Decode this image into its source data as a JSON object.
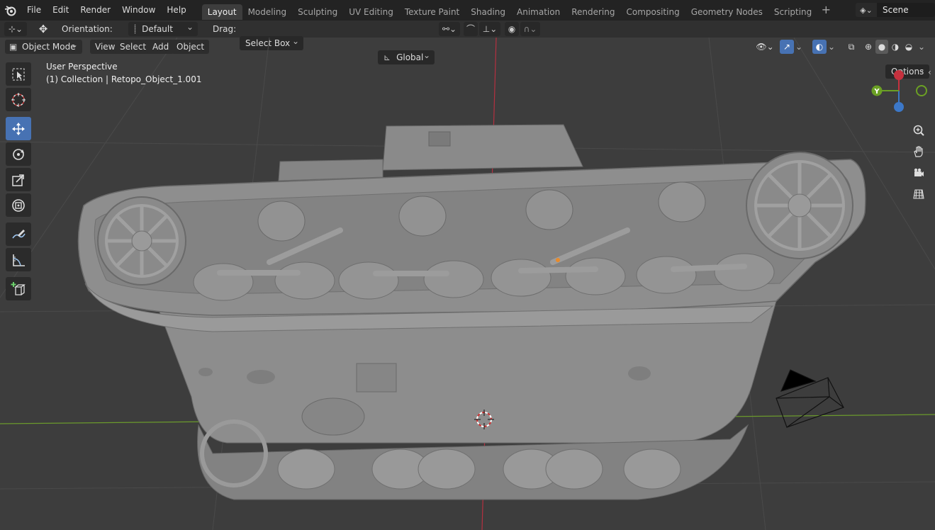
{
  "menu": {
    "file": "File",
    "edit": "Edit",
    "render": "Render",
    "window": "Window",
    "help": "Help"
  },
  "workspaces": [
    "Layout",
    "Modeling",
    "Sculpting",
    "UV Editing",
    "Texture Paint",
    "Shading",
    "Animation",
    "Rendering",
    "Compositing",
    "Geometry Nodes",
    "Scripting"
  ],
  "active_workspace": "Layout",
  "scene": {
    "name": "Scene"
  },
  "tool_header": {
    "orientation_label": "Orientation:",
    "orientation_value": "Default",
    "drag_label": "Drag:",
    "drag_value": "Select Box",
    "transform_orientation": "Global",
    "options": "Options"
  },
  "viewport_header": {
    "mode": "Object Mode",
    "view": "View",
    "select": "Select",
    "add": "Add",
    "object": "Object"
  },
  "viewport": {
    "perspective": "User Perspective",
    "collection_info": "(1) Collection | Retopo_Object_1.001"
  },
  "gizmo": {
    "y_label": "Y"
  },
  "colors": {
    "accent": "#4772b3",
    "x_axis": "#c5313e",
    "y_axis": "#6ba024",
    "z_axis": "#3c78c8",
    "model": "#8c8c8c",
    "background": "#3d3d3d"
  },
  "icons": [
    "blender-logo",
    "select-box-icon",
    "cursor-icon",
    "move-icon",
    "rotate-icon",
    "scale-icon",
    "transform-icon",
    "annotate-icon",
    "measure-icon",
    "add-cube-icon",
    "zoom-icon",
    "hand-icon",
    "camera-icon",
    "grid-icon"
  ]
}
